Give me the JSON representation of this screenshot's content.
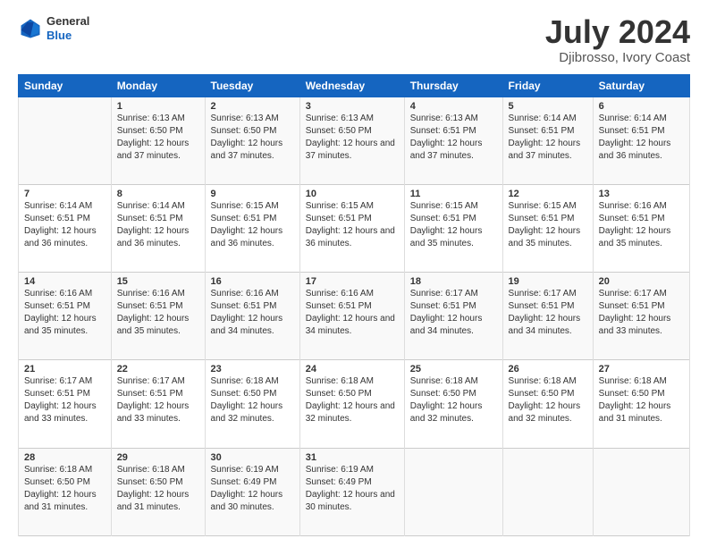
{
  "header": {
    "logo_general": "General",
    "logo_blue": "Blue",
    "title": "July 2024",
    "subtitle": "Djibrosso, Ivory Coast"
  },
  "days_of_week": [
    "Sunday",
    "Monday",
    "Tuesday",
    "Wednesday",
    "Thursday",
    "Friday",
    "Saturday"
  ],
  "weeks": [
    [
      {
        "day": "",
        "sunrise": "",
        "sunset": "",
        "daylight": ""
      },
      {
        "day": "1",
        "sunrise": "Sunrise: 6:13 AM",
        "sunset": "Sunset: 6:50 PM",
        "daylight": "Daylight: 12 hours and 37 minutes."
      },
      {
        "day": "2",
        "sunrise": "Sunrise: 6:13 AM",
        "sunset": "Sunset: 6:50 PM",
        "daylight": "Daylight: 12 hours and 37 minutes."
      },
      {
        "day": "3",
        "sunrise": "Sunrise: 6:13 AM",
        "sunset": "Sunset: 6:50 PM",
        "daylight": "Daylight: 12 hours and 37 minutes."
      },
      {
        "day": "4",
        "sunrise": "Sunrise: 6:13 AM",
        "sunset": "Sunset: 6:51 PM",
        "daylight": "Daylight: 12 hours and 37 minutes."
      },
      {
        "day": "5",
        "sunrise": "Sunrise: 6:14 AM",
        "sunset": "Sunset: 6:51 PM",
        "daylight": "Daylight: 12 hours and 37 minutes."
      },
      {
        "day": "6",
        "sunrise": "Sunrise: 6:14 AM",
        "sunset": "Sunset: 6:51 PM",
        "daylight": "Daylight: 12 hours and 36 minutes."
      }
    ],
    [
      {
        "day": "7",
        "sunrise": "Sunrise: 6:14 AM",
        "sunset": "Sunset: 6:51 PM",
        "daylight": "Daylight: 12 hours and 36 minutes."
      },
      {
        "day": "8",
        "sunrise": "Sunrise: 6:14 AM",
        "sunset": "Sunset: 6:51 PM",
        "daylight": "Daylight: 12 hours and 36 minutes."
      },
      {
        "day": "9",
        "sunrise": "Sunrise: 6:15 AM",
        "sunset": "Sunset: 6:51 PM",
        "daylight": "Daylight: 12 hours and 36 minutes."
      },
      {
        "day": "10",
        "sunrise": "Sunrise: 6:15 AM",
        "sunset": "Sunset: 6:51 PM",
        "daylight": "Daylight: 12 hours and 36 minutes."
      },
      {
        "day": "11",
        "sunrise": "Sunrise: 6:15 AM",
        "sunset": "Sunset: 6:51 PM",
        "daylight": "Daylight: 12 hours and 35 minutes."
      },
      {
        "day": "12",
        "sunrise": "Sunrise: 6:15 AM",
        "sunset": "Sunset: 6:51 PM",
        "daylight": "Daylight: 12 hours and 35 minutes."
      },
      {
        "day": "13",
        "sunrise": "Sunrise: 6:16 AM",
        "sunset": "Sunset: 6:51 PM",
        "daylight": "Daylight: 12 hours and 35 minutes."
      }
    ],
    [
      {
        "day": "14",
        "sunrise": "Sunrise: 6:16 AM",
        "sunset": "Sunset: 6:51 PM",
        "daylight": "Daylight: 12 hours and 35 minutes."
      },
      {
        "day": "15",
        "sunrise": "Sunrise: 6:16 AM",
        "sunset": "Sunset: 6:51 PM",
        "daylight": "Daylight: 12 hours and 35 minutes."
      },
      {
        "day": "16",
        "sunrise": "Sunrise: 6:16 AM",
        "sunset": "Sunset: 6:51 PM",
        "daylight": "Daylight: 12 hours and 34 minutes."
      },
      {
        "day": "17",
        "sunrise": "Sunrise: 6:16 AM",
        "sunset": "Sunset: 6:51 PM",
        "daylight": "Daylight: 12 hours and 34 minutes."
      },
      {
        "day": "18",
        "sunrise": "Sunrise: 6:17 AM",
        "sunset": "Sunset: 6:51 PM",
        "daylight": "Daylight: 12 hours and 34 minutes."
      },
      {
        "day": "19",
        "sunrise": "Sunrise: 6:17 AM",
        "sunset": "Sunset: 6:51 PM",
        "daylight": "Daylight: 12 hours and 34 minutes."
      },
      {
        "day": "20",
        "sunrise": "Sunrise: 6:17 AM",
        "sunset": "Sunset: 6:51 PM",
        "daylight": "Daylight: 12 hours and 33 minutes."
      }
    ],
    [
      {
        "day": "21",
        "sunrise": "Sunrise: 6:17 AM",
        "sunset": "Sunset: 6:51 PM",
        "daylight": "Daylight: 12 hours and 33 minutes."
      },
      {
        "day": "22",
        "sunrise": "Sunrise: 6:17 AM",
        "sunset": "Sunset: 6:51 PM",
        "daylight": "Daylight: 12 hours and 33 minutes."
      },
      {
        "day": "23",
        "sunrise": "Sunrise: 6:18 AM",
        "sunset": "Sunset: 6:50 PM",
        "daylight": "Daylight: 12 hours and 32 minutes."
      },
      {
        "day": "24",
        "sunrise": "Sunrise: 6:18 AM",
        "sunset": "Sunset: 6:50 PM",
        "daylight": "Daylight: 12 hours and 32 minutes."
      },
      {
        "day": "25",
        "sunrise": "Sunrise: 6:18 AM",
        "sunset": "Sunset: 6:50 PM",
        "daylight": "Daylight: 12 hours and 32 minutes."
      },
      {
        "day": "26",
        "sunrise": "Sunrise: 6:18 AM",
        "sunset": "Sunset: 6:50 PM",
        "daylight": "Daylight: 12 hours and 32 minutes."
      },
      {
        "day": "27",
        "sunrise": "Sunrise: 6:18 AM",
        "sunset": "Sunset: 6:50 PM",
        "daylight": "Daylight: 12 hours and 31 minutes."
      }
    ],
    [
      {
        "day": "28",
        "sunrise": "Sunrise: 6:18 AM",
        "sunset": "Sunset: 6:50 PM",
        "daylight": "Daylight: 12 hours and 31 minutes."
      },
      {
        "day": "29",
        "sunrise": "Sunrise: 6:18 AM",
        "sunset": "Sunset: 6:50 PM",
        "daylight": "Daylight: 12 hours and 31 minutes."
      },
      {
        "day": "30",
        "sunrise": "Sunrise: 6:19 AM",
        "sunset": "Sunset: 6:49 PM",
        "daylight": "Daylight: 12 hours and 30 minutes."
      },
      {
        "day": "31",
        "sunrise": "Sunrise: 6:19 AM",
        "sunset": "Sunset: 6:49 PM",
        "daylight": "Daylight: 12 hours and 30 minutes."
      },
      {
        "day": "",
        "sunrise": "",
        "sunset": "",
        "daylight": ""
      },
      {
        "day": "",
        "sunrise": "",
        "sunset": "",
        "daylight": ""
      },
      {
        "day": "",
        "sunrise": "",
        "sunset": "",
        "daylight": ""
      }
    ]
  ]
}
